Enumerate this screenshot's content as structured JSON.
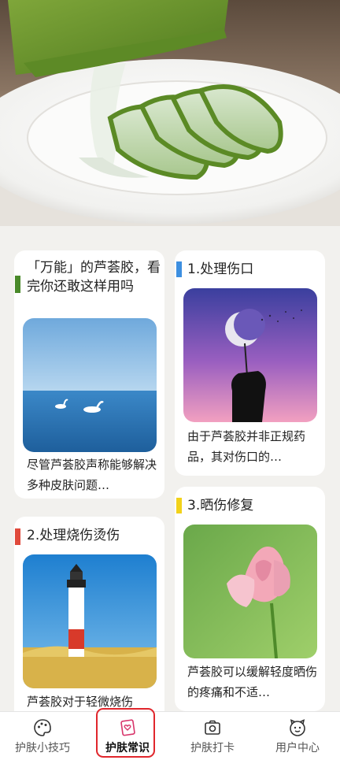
{
  "cards": [
    {
      "title": "「万能」的芦荟胶，看完你还敢这样用吗",
      "desc": "尽管芦荟胶声称能够解决多种皮肤问题…",
      "accent": "#4a8a2a"
    },
    {
      "title": "1.处理伤口",
      "desc": "由于芦荟胶并非正规药品，其对伤口的…",
      "accent": "#3d8fe0"
    },
    {
      "title": "2.处理烧伤烫伤",
      "desc": "芦荟胶对于轻微烧伤",
      "accent": "#e04a3c"
    },
    {
      "title": "3.晒伤修复",
      "desc": "芦荟胶可以缓解轻度晒伤的疼痛和不适…",
      "accent": "#f2d21a"
    }
  ],
  "tabs": [
    {
      "label": "护肤小技巧",
      "icon": "palette-icon"
    },
    {
      "label": "护肤常识",
      "icon": "heart-card-icon",
      "active": true
    },
    {
      "label": "护肤打卡",
      "icon": "camera-icon"
    },
    {
      "label": "用户中心",
      "icon": "smiley-icon"
    }
  ],
  "colors": {
    "highlight": "#e0262c"
  }
}
